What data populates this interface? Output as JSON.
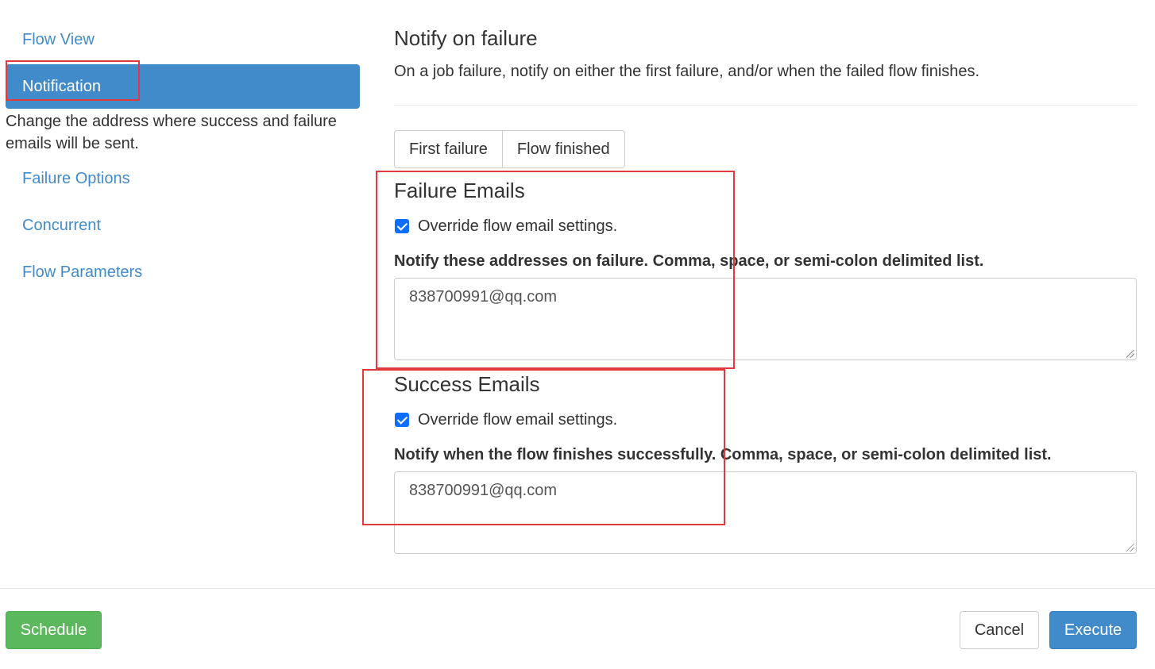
{
  "sidebar": {
    "items": [
      {
        "label": "Flow View"
      },
      {
        "label": "Notification",
        "description": "Change the address where success and failure emails will be sent."
      },
      {
        "label": "Failure Options"
      },
      {
        "label": "Concurrent"
      },
      {
        "label": "Flow Parameters"
      }
    ]
  },
  "main": {
    "title": "Notify on failure",
    "description": "On a job failure, notify on either the first failure, and/or when the failed flow finishes.",
    "notify_options": [
      "First failure",
      "Flow finished"
    ],
    "failure": {
      "title": "Failure Emails",
      "override_label": "Override flow email settings.",
      "override_checked": true,
      "field_label": "Notify these addresses on failure. Comma, space, or semi-colon delimited list.",
      "value": "838700991@qq.com"
    },
    "success": {
      "title": "Success Emails",
      "override_label": "Override flow email settings.",
      "override_checked": true,
      "field_label": "Notify when the flow finishes successfully. Comma, space, or semi-colon delimited list.",
      "value": "838700991@qq.com"
    }
  },
  "footer": {
    "schedule_label": "Schedule",
    "cancel_label": "Cancel",
    "execute_label": "Execute"
  },
  "colors": {
    "primary": "#428bca",
    "success": "#5cb85c",
    "highlight": "#e23a3a",
    "checkbox": "#0d6efd"
  }
}
